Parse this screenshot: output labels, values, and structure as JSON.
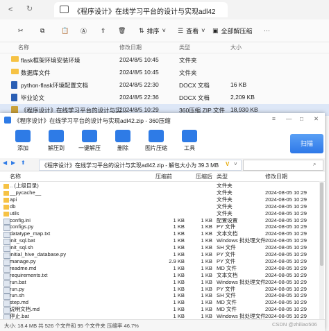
{
  "explorer": {
    "tab_title": "《程序设计》在线学习平台的设计与实现adl42",
    "toolbar": {
      "sort_label": "排序",
      "view_label": "查看",
      "extract_all_label": "全部解压缩",
      "more_label": "···"
    },
    "columns": {
      "name": "名称",
      "date": "修改日期",
      "type": "类型",
      "size": "大小"
    },
    "rows": [
      {
        "name": "flask框架环境安装环境",
        "date": "2024/8/5 10:45",
        "type": "文件夹",
        "size": ""
      },
      {
        "name": "数据库文件",
        "date": "2024/8/5 10:45",
        "type": "文件夹",
        "size": ""
      },
      {
        "name": "python-flask环境配置文档",
        "date": "2024/8/5 22:30",
        "type": "DOCX 文档",
        "size": "16 KB"
      },
      {
        "name": "毕业论文",
        "date": "2024/8/5 22:36",
        "type": "DOCX 文档",
        "size": "2,209 KB"
      },
      {
        "name": "《程序设计》在线学习平台的设计与实...",
        "date": "2024/8/5 10:29",
        "type": "360压缩 ZIP 文件",
        "size": "18,930 KB"
      }
    ]
  },
  "zip": {
    "title": "《程序设计》在线学习平台的设计与实现adl42.zip - 360压缩",
    "tools": [
      {
        "label": "添加",
        "color": "#2e7be6"
      },
      {
        "label": "解压到",
        "color": "#2e7be6"
      },
      {
        "label": "一键解压",
        "color": "#2e7be6"
      },
      {
        "label": "删除",
        "color": "#2e7be6"
      },
      {
        "label": "图片压缩",
        "color": "#2e7be6"
      },
      {
        "label": "工具",
        "color": "#2e7be6"
      }
    ],
    "scan_label": "扫描",
    "address": "《程序设计》在线学习平台的设计与实现adl42.zip - 解包大小为 39.3 MB",
    "columns": {
      "name": "名称",
      "compressed": "压缩前",
      "after": "压缩后",
      "type": "类型",
      "date": "修改日期"
    },
    "rows": [
      {
        "name": ".. (上级目录)",
        "compressed": "",
        "after": "",
        "type": "文件夹",
        "date": ""
      },
      {
        "name": "__pycache__",
        "compressed": "",
        "after": "",
        "type": "文件夹",
        "date": "2024-08-05 10:29"
      },
      {
        "name": "api",
        "compressed": "",
        "after": "",
        "type": "文件夹",
        "date": "2024-08-05 10:29"
      },
      {
        "name": "db",
        "compressed": "",
        "after": "",
        "type": "文件夹",
        "date": "2024-08-05 10:29"
      },
      {
        "name": "utils",
        "compressed": "",
        "after": "",
        "type": "文件夹",
        "date": "2024-08-05 10:29"
      },
      {
        "name": "config.ini",
        "compressed": "1 KB",
        "after": "1 KB",
        "type": "配置设置",
        "date": "2024-08-05 10:29"
      },
      {
        "name": "configs.py",
        "compressed": "1 KB",
        "after": "1 KB",
        "type": "PY 文件",
        "date": "2024-08-05 10:29"
      },
      {
        "name": "datatype_map.txt",
        "compressed": "1 KB",
        "after": "1 KB",
        "type": "文本文档",
        "date": "2024-08-05 10:29"
      },
      {
        "name": "init_sql.bat",
        "compressed": "1 KB",
        "after": "1 KB",
        "type": "Windows 批处理文件",
        "date": "2024-08-05 10:29"
      },
      {
        "name": "init_sql.sh",
        "compressed": "1 KB",
        "after": "1 KB",
        "type": "SH 文件",
        "date": "2024-08-05 10:29"
      },
      {
        "name": "initial_hive_database.py",
        "compressed": "1 KB",
        "after": "1 KB",
        "type": "PY 文件",
        "date": "2024-08-05 10:29"
      },
      {
        "name": "manage.py",
        "compressed": "2.9 KB",
        "after": "1 KB",
        "type": "PY 文件",
        "date": "2024-08-05 10:29"
      },
      {
        "name": "readme.md",
        "compressed": "1 KB",
        "after": "1 KB",
        "type": "MD 文件",
        "date": "2024-08-05 10:29"
      },
      {
        "name": "requirements.txt",
        "compressed": "1 KB",
        "after": "1 KB",
        "type": "文本文档",
        "date": "2024-08-05 10:29"
      },
      {
        "name": "run.bat",
        "compressed": "1 KB",
        "after": "1 KB",
        "type": "Windows 批处理文件",
        "date": "2024-08-05 10:29"
      },
      {
        "name": "run.py",
        "compressed": "1 KB",
        "after": "1 KB",
        "type": "PY 文件",
        "date": "2024-08-05 10:29"
      },
      {
        "name": "run.sh",
        "compressed": "1 KB",
        "after": "1 KB",
        "type": "SH 文件",
        "date": "2024-08-05 10:29"
      },
      {
        "name": "step.md",
        "compressed": "1 KB",
        "after": "1 KB",
        "type": "MD 文件",
        "date": "2024-08-05 10:29"
      },
      {
        "name": "说明文档.md",
        "compressed": "1 KB",
        "after": "1 KB",
        "type": "MD 文件",
        "date": "2024-08-05 10:29"
      },
      {
        "name": "停止.bat",
        "compressed": "1 KB",
        "after": "1 KB",
        "type": "Windows 批处理文件",
        "date": "2024-08-05 10:29"
      }
    ],
    "status": "大小: 18.4 MB 共 526 个文件和 95 个文件夹 压缩率 46.7%"
  },
  "watermark": "CSDN @zhiliao506"
}
